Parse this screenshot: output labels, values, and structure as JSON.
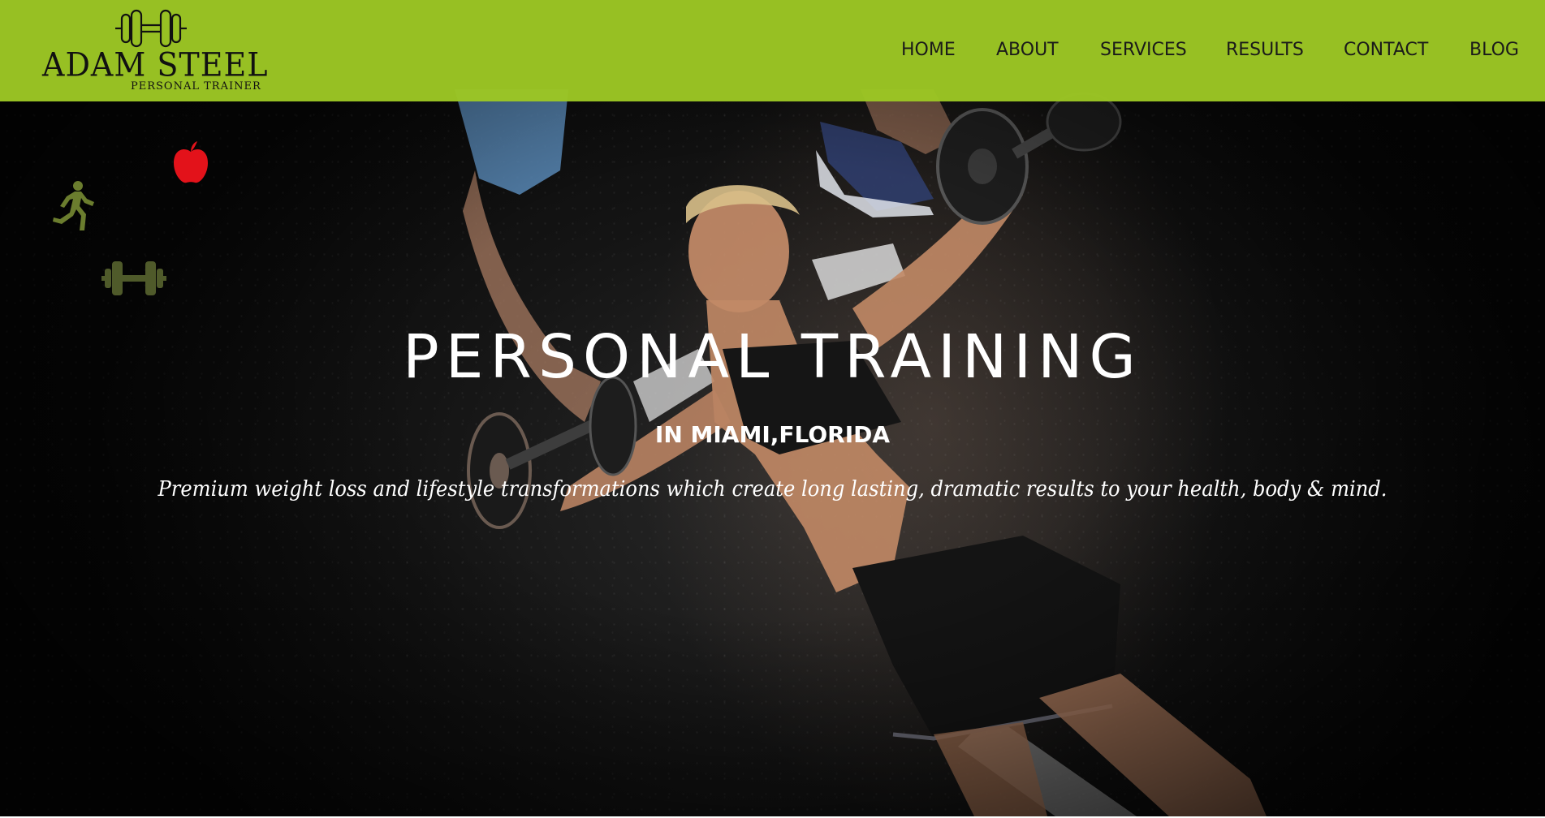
{
  "brand": {
    "name": "ADAM STEEL",
    "tagline": "PERSONAL TRAINER",
    "logo_icon": "dumbbell-icon"
  },
  "nav": {
    "items": [
      {
        "label": "HOME"
      },
      {
        "label": "ABOUT"
      },
      {
        "label": "SERVICES"
      },
      {
        "label": "RESULTS"
      },
      {
        "label": "CONTACT"
      },
      {
        "label": "BLOG"
      }
    ]
  },
  "hero": {
    "title": "PERSONAL TRAINING",
    "subtitle": "IN MIAMI,FLORIDA",
    "tagline": "Premium weight loss and lifestyle transformations which create long lasting, dramatic results to your health, body & mind."
  },
  "floating_icons": [
    {
      "name": "apple-icon",
      "color": "#e3121a"
    },
    {
      "name": "running-person-icon",
      "color": "#6b7d2e"
    },
    {
      "name": "dumbbell-icon",
      "color": "#4f5a2a"
    }
  ],
  "colors": {
    "header_bg": "#9cc624",
    "nav_text": "#1a1a1a",
    "hero_text": "#ffffff",
    "hero_bg": "#0d0d0d"
  }
}
